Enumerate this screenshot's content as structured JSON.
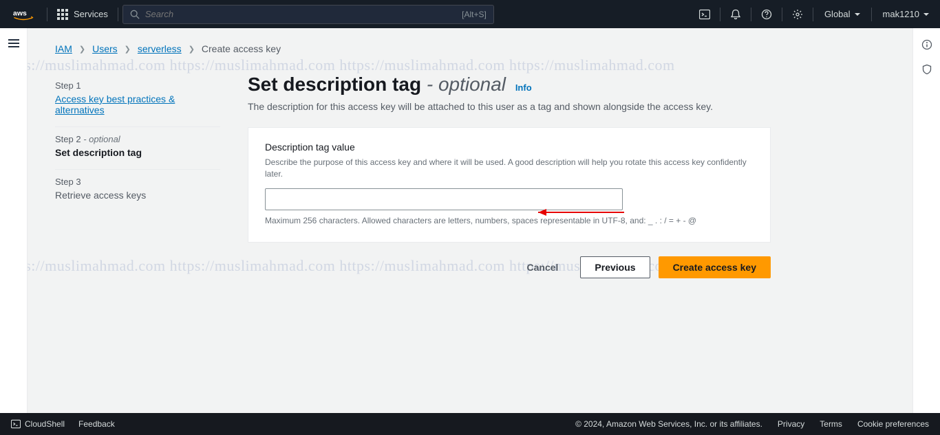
{
  "topnav": {
    "services": "Services",
    "search_placeholder": "Search",
    "search_shortcut": "[Alt+S]",
    "region": "Global",
    "user": "mak1210"
  },
  "breadcrumb": {
    "items": [
      "IAM",
      "Users",
      "serverless"
    ],
    "current": "Create access key"
  },
  "steps": [
    {
      "label": "Step 1",
      "title": "Access key best practices & alternatives"
    },
    {
      "label": "Step 2",
      "optional": "- optional",
      "title": "Set description tag"
    },
    {
      "label": "Step 3",
      "title": "Retrieve access keys"
    }
  ],
  "page": {
    "title_main": "Set description tag",
    "title_dash": " - ",
    "title_optional": "optional",
    "info": "Info",
    "description": "The description for this access key will be attached to this user as a tag and shown alongside the access key."
  },
  "field": {
    "label": "Description tag value",
    "help": "Describe the purpose of this access key and where it will be used. A good description will help you rotate this access key confidently later.",
    "value": "",
    "constraint": "Maximum 256 characters. Allowed characters are letters, numbers, spaces representable in UTF-8, and: _ . : / = + - @"
  },
  "actions": {
    "cancel": "Cancel",
    "previous": "Previous",
    "create": "Create access key"
  },
  "footer": {
    "cloudshell": "CloudShell",
    "feedback": "Feedback",
    "copyright": "© 2024, Amazon Web Services, Inc. or its affiliates.",
    "privacy": "Privacy",
    "terms": "Terms",
    "cookies": "Cookie preferences"
  },
  "watermark": "https://muslimahmad.com   https://muslimahmad.com   https://muslimahmad.com   https://muslimahmad.com"
}
